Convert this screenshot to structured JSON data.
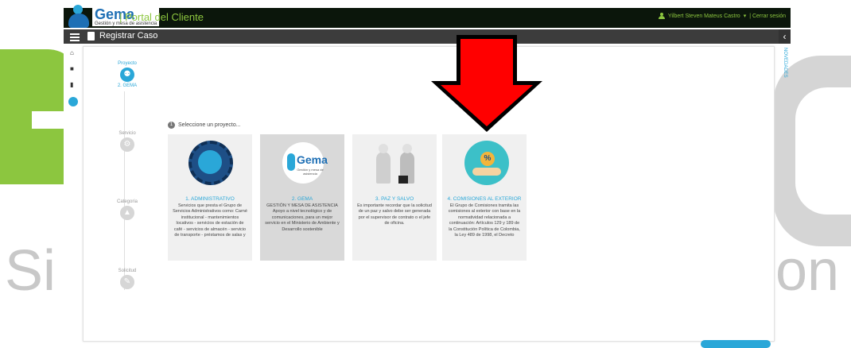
{
  "header": {
    "logo_main": "Gema",
    "logo_sub": "Gestión y mesa de asistencia",
    "portal_title": "| Portal del Cliente",
    "user_name": "Yilbert Steven Mateus Castro",
    "user_caret": "▾",
    "logout_label": "| Cerrar sesión"
  },
  "subbar": {
    "title": "Registrar Caso",
    "collapse_glyph": "‹"
  },
  "sidebar": {
    "icons": [
      "home-icon",
      "trash-icon",
      "book-icon",
      "active-dot-icon"
    ]
  },
  "novedades": {
    "label": "NOVEDADES"
  },
  "stepper": {
    "steps": [
      {
        "label": "Proyecto",
        "sub": "2. GEMA",
        "icon": "project-icon",
        "active": true
      },
      {
        "label": "Servicio",
        "sub": "",
        "icon": "service-icon",
        "active": false
      },
      {
        "label": "Categoria",
        "sub": "",
        "icon": "category-icon",
        "active": false
      },
      {
        "label": "Solicitud",
        "sub": "",
        "icon": "request-icon",
        "active": false
      }
    ]
  },
  "prompt": {
    "number": "1",
    "text": "Seleccione un proyecto..."
  },
  "cards": [
    {
      "title": "1. ADMINISTRATIVO",
      "desc": "Servicios que presta el Grupo de Servicios Administrativos como: Carné institucional - mantenimientos locativos - servicios de estación de café - servicios de almacén - servicio de transporte - préstamos de salas y",
      "selected": false
    },
    {
      "title": "2. GEMA",
      "subtitle": "GESTIÓN Y MESA DE ASISTENCIA",
      "desc": "Apoyo a nivel tecnológico y de comunicaciones, para un mejor servicio en el Ministerio de Ambiente y Desarrollo sostenible",
      "logo_title": "Gema",
      "logo_sub": "Gestión y mesa de asistencia",
      "selected": true
    },
    {
      "title": "3. PAZ Y SALVO",
      "desc": "Es importante recordar que la solicitud de un paz y salvo debe ser generada por el supervisor de contrato o el jefe de oficina.",
      "selected": false
    },
    {
      "title": "4. COMISIONES AL EXTERIOR",
      "desc": "El Grupo de Comisiones tramita las comisiones al exterior con base en la normatividad relacionada a continuación: Artículos 129 y 189 de la Constitución Política de Colombia, la Ley 489 de 1998, el Decreto",
      "coin_glyph": "%",
      "selected": false
    }
  ],
  "watermark": {
    "left_text": "Si",
    "right_text": "on"
  },
  "colors": {
    "accent": "#2aa7d8",
    "brand_green": "#8cc63f",
    "topbar": "#0b160b",
    "subbar": "#3c3c3c",
    "arrow": "#ff0000"
  }
}
